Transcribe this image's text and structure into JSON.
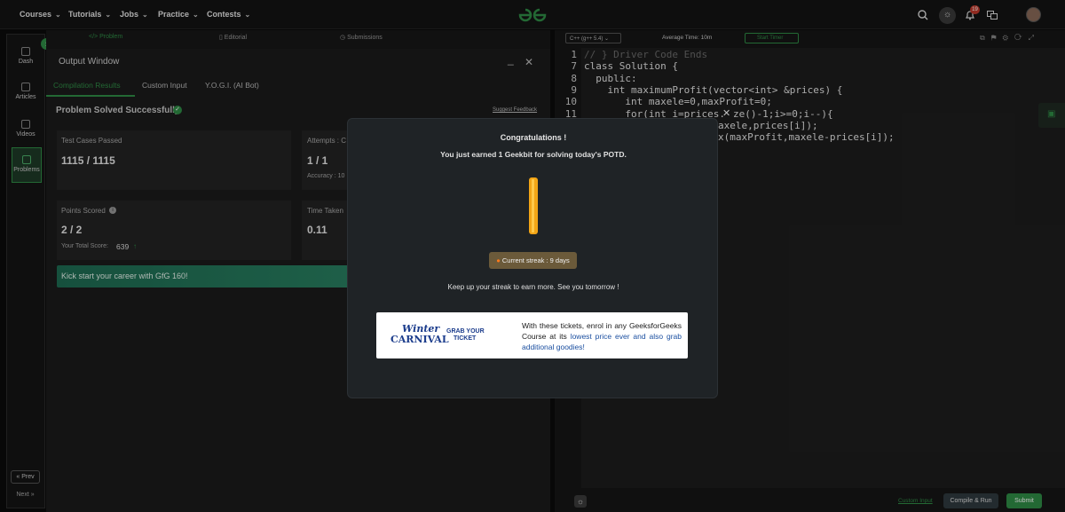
{
  "nav": {
    "items": [
      "Courses",
      "Tutorials",
      "Jobs",
      "Practice",
      "Contests"
    ],
    "notification_count": "19"
  },
  "rail": {
    "items": [
      "Dash",
      "Articles",
      "Videos",
      "Problems"
    ],
    "prev": "« Prev",
    "next": "Next »"
  },
  "problem_tabs": [
    "Problem",
    "Editorial",
    "Submissions"
  ],
  "output": {
    "title": "Output Window",
    "tabs": [
      "Compilation Results",
      "Custom Input",
      "Y.O.G.I. (AI Bot)"
    ],
    "status": "Problem Solved Successfully",
    "suggest": "Suggest Feedback",
    "test_label": "Test Cases Passed",
    "test_value": "1115 / 1115",
    "attempts_label": "Attempts : C",
    "attempts_value": "1 / 1",
    "accuracy_label": "Accuracy : 10",
    "points_label": "Points Scored",
    "points_value": "2 / 2",
    "total_score_label": "Your Total Score:",
    "total_score": "639",
    "time_label": "Time Taken",
    "time_value": "0.11",
    "promo": "Kick start your career with GfG 160!"
  },
  "editor": {
    "language": "C++ (g++ 5.4)",
    "avg_time": "Average Time: 10m",
    "timer": "Start Timer",
    "line_numbers": [
      "1",
      "7",
      "8",
      "9",
      "10",
      "11"
    ],
    "lines": [
      "// } Driver Code Ends",
      "class Solution {",
      "  public:",
      "    int maximumProfit(vector<int> &prices) {",
      "       int maxele=0,maxProfit=0;",
      "       for(int i=prices.",
      "ze()-1;i>=0;i--){",
      "axele,prices[i]);",
      "x(maxProfit,maxele-prices[i]);"
    ],
    "custom_input": "Custom Input",
    "compile": "Compile & Run",
    "submit": "Submit"
  },
  "modal": {
    "title": "Congratulations !",
    "subtitle": "You just earned 1 Geekbit for solving today's POTD.",
    "streak": "Current streak : 9 days",
    "keep": "Keep up your streak to earn more. See you tomorrow !",
    "banner_logo_1": "Winter",
    "banner_logo_2": "CARNIVAL",
    "banner_grab_1": "GRAB YOUR",
    "banner_grab_2": "TICKET",
    "banner_text_a": "With these tickets, enrol in any GeeksforGeeks Course at its ",
    "banner_text_b": "lowest price ever and also grab additional goodies!"
  },
  "colors": {
    "accent_green": "#2f8d46",
    "coin_gold": "#f2a516",
    "link_blue": "#1b4fa0"
  }
}
